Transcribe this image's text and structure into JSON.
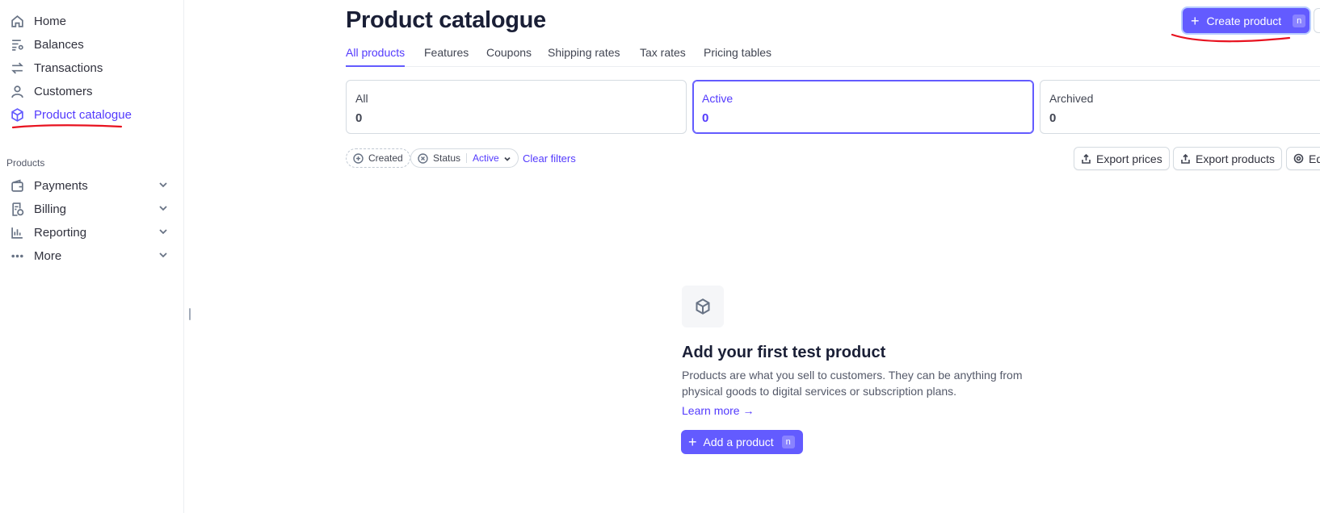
{
  "sidebar": {
    "items": [
      {
        "label": "Home",
        "icon": "home-icon"
      },
      {
        "label": "Balances",
        "icon": "balances-icon"
      },
      {
        "label": "Transactions",
        "icon": "transactions-icon"
      },
      {
        "label": "Customers",
        "icon": "customers-icon"
      },
      {
        "label": "Product catalogue",
        "icon": "product-box-icon",
        "active": true
      }
    ],
    "section_label": "Products",
    "products_items": [
      {
        "label": "Payments",
        "icon": "wallet-icon"
      },
      {
        "label": "Billing",
        "icon": "billing-icon"
      },
      {
        "label": "Reporting",
        "icon": "reporting-icon"
      },
      {
        "label": "More",
        "icon": "more-dots-icon"
      }
    ]
  },
  "header": {
    "title": "Product catalogue",
    "create_button": "Create product",
    "create_shortcut": "n"
  },
  "tabs": [
    "All products",
    "Features",
    "Coupons",
    "Shipping rates",
    "Tax rates",
    "Pricing tables"
  ],
  "summary_cards": [
    {
      "label": "All",
      "count": "0"
    },
    {
      "label": "Active",
      "count": "0"
    },
    {
      "label": "Archived",
      "count": "0"
    }
  ],
  "filters": {
    "created_label": "Created",
    "status_label": "Status",
    "status_value": "Active",
    "clear": "Clear filters"
  },
  "toolbar": {
    "export_prices": "Export prices",
    "export_products": "Export products",
    "edit_partial": "Ed"
  },
  "empty_state": {
    "title": "Add your first test product",
    "description": "Products are what you sell to customers. They can be anything from physical goods to digital services or subscription plans.",
    "learn_more": "Learn more →",
    "add_button": "Add a product",
    "add_shortcut": "n"
  },
  "colors": {
    "accent": "#635bff",
    "accent_text": "#533afd",
    "annotation": "#e8121f"
  }
}
